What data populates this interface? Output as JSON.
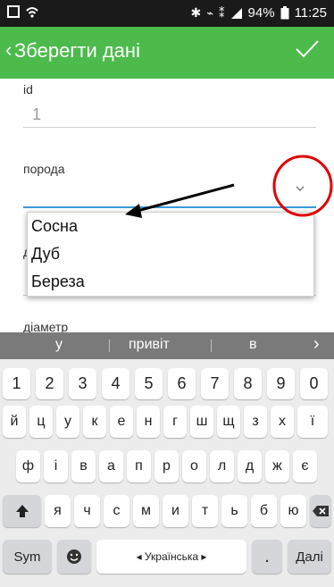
{
  "status_bar": {
    "icons": [
      "notification-icon",
      "wifi-icon",
      "bluetooth-icon",
      "mute-icon",
      "sim-icon",
      "signal-icon"
    ],
    "battery": "94%",
    "time": "11:25"
  },
  "app_bar": {
    "back_glyph": "‹",
    "title": "Зберегти дані",
    "confirm_icon": "check-icon"
  },
  "form": {
    "fields": [
      {
        "label": "id",
        "value": "1"
      },
      {
        "label": "порода",
        "value": ""
      },
      {
        "label": "д",
        "value": ""
      },
      {
        "label": "діаметр",
        "value": ""
      }
    ]
  },
  "dropdown": {
    "options": [
      "Сосна",
      "Дуб",
      "Береза"
    ]
  },
  "annotations": {
    "arrow_color": "#000000",
    "circle_color": "#e00000"
  },
  "keyboard": {
    "suggestions": [
      "у",
      "привіт",
      "в"
    ],
    "suggest_arrow": "›",
    "row_numbers": [
      "1",
      "2",
      "3",
      "4",
      "5",
      "6",
      "7",
      "8",
      "9",
      "0"
    ],
    "row1": [
      "й",
      "ц",
      "у",
      "к",
      "е",
      "н",
      "г",
      "ш",
      "щ",
      "з",
      "х",
      "ї"
    ],
    "row2": [
      "ф",
      "і",
      "в",
      "а",
      "п",
      "р",
      "о",
      "л",
      "д",
      "ж",
      "є"
    ],
    "row3": [
      "я",
      "ч",
      "с",
      "м",
      "и",
      "т",
      "ь",
      "б",
      "ю"
    ],
    "sym_label": "Sym",
    "space_label": "◂ Українська ▸",
    "period_label": ".",
    "next_label": "Далі"
  },
  "colors": {
    "app_bar": "#4cbb4c",
    "status_bar": "#1a1a1a",
    "focus_line": "#3a9bdc",
    "suggest_bar": "#7a7a7a"
  }
}
